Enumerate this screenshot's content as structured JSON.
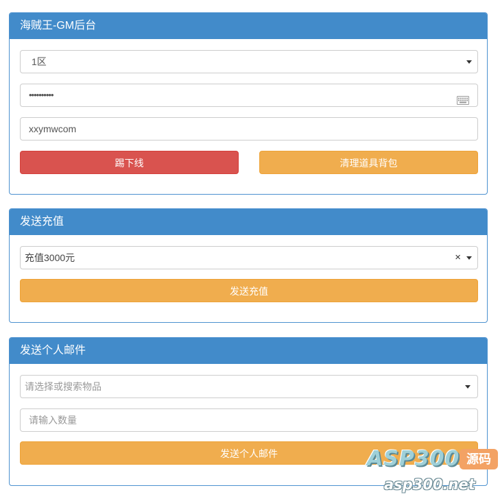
{
  "panel1": {
    "title": "海贼王-GM后台",
    "server_select": {
      "value": "1区"
    },
    "password_field": {
      "value": "••••••••••"
    },
    "account_field": {
      "value": "xxymwcom"
    },
    "kick_button": "踢下线",
    "clear_bag_button": "清理道具背包"
  },
  "panel2": {
    "title": "发送充值",
    "recharge_select": {
      "value": "充值3000元",
      "clear_symbol": "×"
    },
    "send_button": "发送充值"
  },
  "panel3": {
    "title": "发送个人邮件",
    "item_select": {
      "placeholder": "请选择或搜索物品"
    },
    "quantity_input": {
      "placeholder": "请输入数量"
    },
    "send_button": "发送个人邮件"
  },
  "watermark": {
    "brand": "ASP300",
    "badge": "源码",
    "url": "asp300.net"
  },
  "colors": {
    "panel_header": "#428bca",
    "danger": "#d9534f",
    "warning": "#f0ad4e"
  }
}
